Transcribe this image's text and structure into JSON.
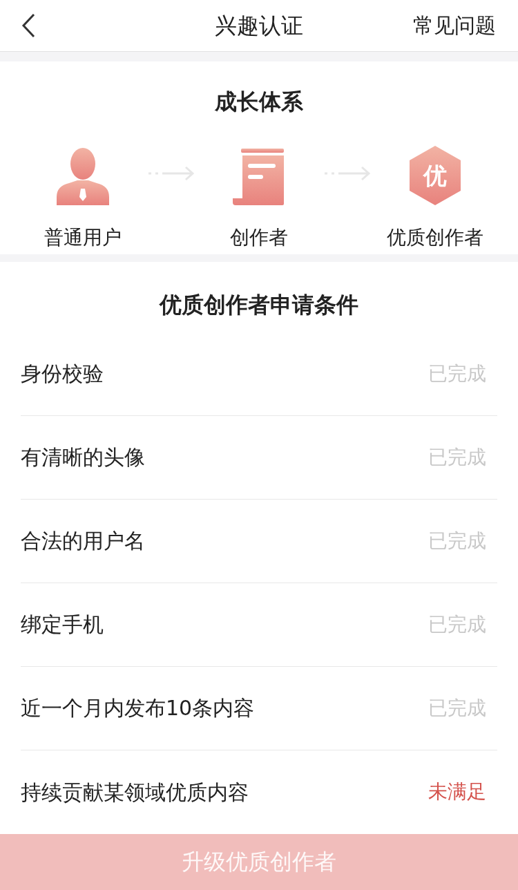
{
  "header": {
    "title": "兴趣认证",
    "action": "常见问题"
  },
  "growth": {
    "title": "成长体系",
    "steps": [
      {
        "kind": "person",
        "label": "普通用户"
      },
      {
        "kind": "document",
        "label": "创作者"
      },
      {
        "kind": "badge",
        "badge_text": "优",
        "label": "优质创作者"
      }
    ]
  },
  "conditions": {
    "title": "优质创作者申请条件",
    "items": [
      {
        "label": "身份校验",
        "status": "已完成",
        "done": true
      },
      {
        "label": "有清晰的头像",
        "status": "已完成",
        "done": true
      },
      {
        "label": "合法的用户名",
        "status": "已完成",
        "done": true
      },
      {
        "label": "绑定手机",
        "status": "已完成",
        "done": true
      },
      {
        "label": "近一个月内发布10条内容",
        "status": "已完成",
        "done": true
      },
      {
        "label": "持续贡献某领域优质内容",
        "status": "未满足",
        "done": false
      }
    ]
  },
  "button": {
    "label": "升级优质创作者",
    "disabled": true
  }
}
